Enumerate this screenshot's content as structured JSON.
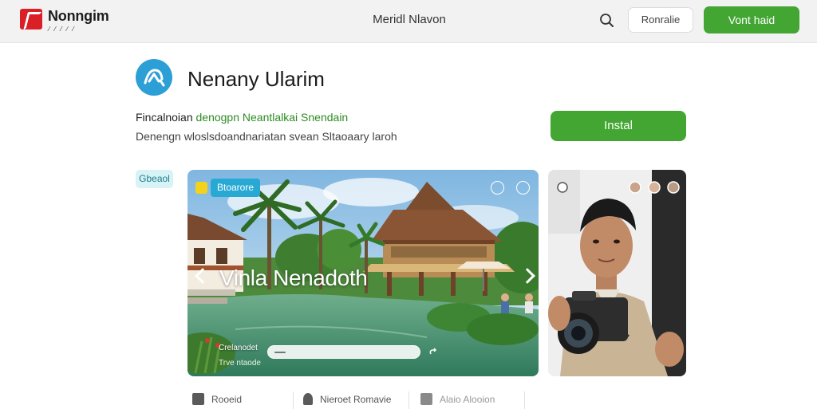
{
  "header": {
    "brand_name": "Nonngim",
    "brand_sub": "⁄ ⁄ ⁄ ⁄ ⁄",
    "nav_title": "Meridl Nlavon",
    "secondary_button": "Ronralie",
    "primary_button": "Vont haid"
  },
  "app": {
    "name": "Nenany Ularim",
    "tagline_prefix": "Fincalnoian ",
    "tagline_highlight": "denogpn Neantlalkai Snendain",
    "description": "Denengn wloslsdoandnariatan svean Sltaoaary laroh",
    "install_label": "Instal",
    "side_badge": "Gbeaol"
  },
  "carousel": {
    "badge_label": "Btoarore",
    "title": "Vinla Nenadoth",
    "caption": "Crelanodet",
    "caption2": "Trve ntaode"
  },
  "bottom_tabs": [
    {
      "label": "Rooeid",
      "icon": "house-icon"
    },
    {
      "label": "Nieroet Romavie",
      "icon": "person-icon"
    },
    {
      "label": "Alaio Alooion",
      "icon": "camera-icon"
    }
  ],
  "colors": {
    "brand_red": "#d92027",
    "accent_green": "#43a633",
    "accent_blue": "#2b9fd6",
    "badge_blue": "#27a9d4",
    "badge_yellow": "#f2d21b",
    "topbar_bg": "#f2f2f2"
  }
}
